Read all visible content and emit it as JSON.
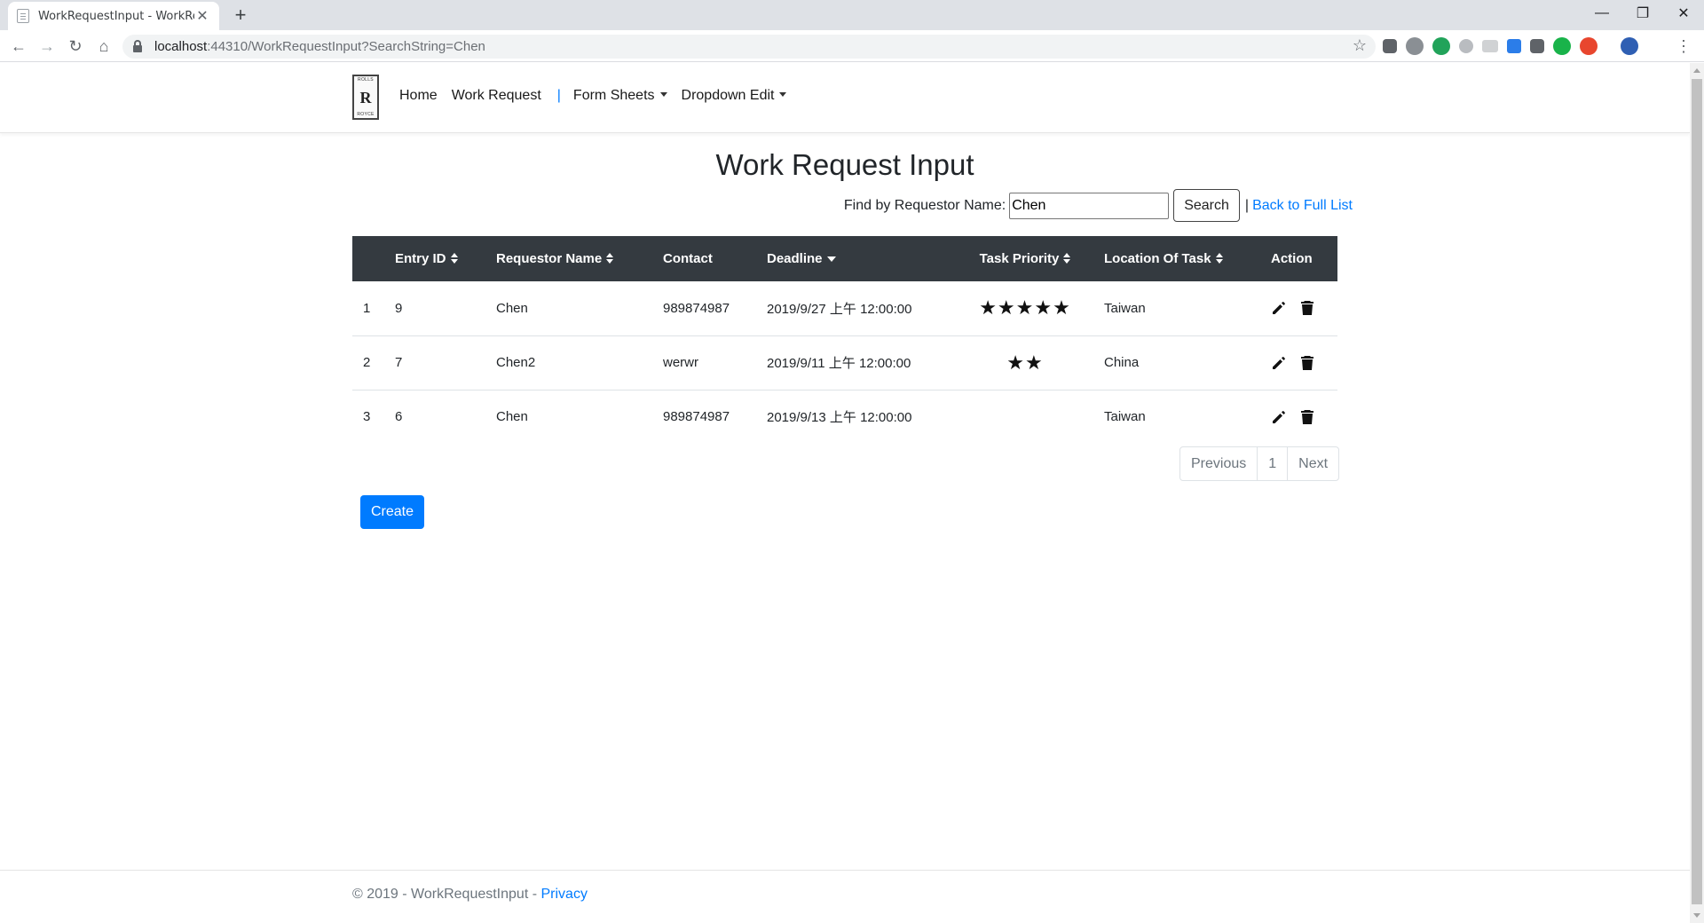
{
  "browser": {
    "tab_title": "WorkRequestInput - WorkRequ",
    "url_host": "localhost",
    "url_rest": ":44310/WorkRequestInput?SearchString=Chen"
  },
  "nav": {
    "brand_top": "ROLLS",
    "brand_mark": "R",
    "brand_bottom": "ROYCE",
    "home": "Home",
    "work_request": "Work Request",
    "separator": "|",
    "form_sheets": "Form Sheets",
    "dropdown_edit": "Dropdown Edit"
  },
  "page": {
    "title": "Work Request Input",
    "search_label": "Find by Requestor Name:",
    "search_value": "Chen",
    "search_button": "Search",
    "pipe": "|",
    "back_link": "Back to Full List"
  },
  "table": {
    "headers": {
      "entry_id": "Entry ID",
      "requestor": "Requestor Name",
      "contact": "Contact",
      "deadline": "Deadline",
      "priority": "Task Priority",
      "location": "Location Of Task",
      "action": "Action"
    },
    "rows": [
      {
        "index": "1",
        "entry_id": "9",
        "requestor": "Chen",
        "contact": "989874987",
        "deadline": "2019/9/27 上午 12:00:00",
        "stars": "★★★★★",
        "priority": 5,
        "location": "Taiwan"
      },
      {
        "index": "2",
        "entry_id": "7",
        "requestor": "Chen2",
        "contact": "werwr",
        "deadline": "2019/9/11 上午 12:00:00",
        "stars": "★★",
        "priority": 2,
        "location": "China"
      },
      {
        "index": "3",
        "entry_id": "6",
        "requestor": "Chen",
        "contact": "989874987",
        "deadline": "2019/9/13 上午 12:00:00",
        "stars": "",
        "priority": 0,
        "location": "Taiwan"
      }
    ]
  },
  "pagination": {
    "previous": "Previous",
    "page": "1",
    "next": "Next"
  },
  "create_button": "Create",
  "footer": {
    "copyright": "© 2019 - WorkRequestInput - ",
    "privacy": "Privacy"
  },
  "colors": {
    "primary": "#007bff",
    "table_header": "#343a40"
  }
}
